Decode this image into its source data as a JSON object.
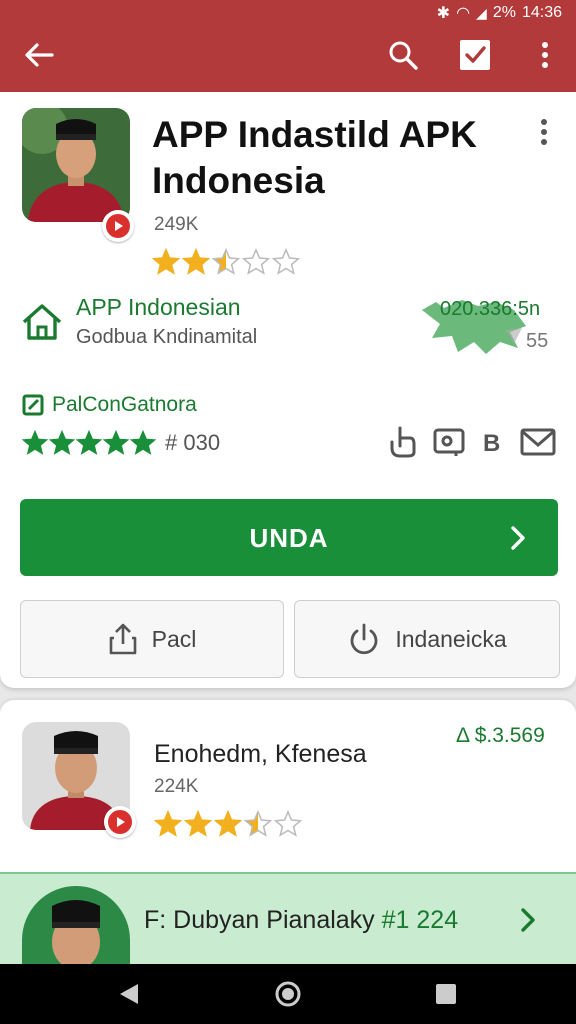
{
  "status_bar": {
    "time": "14:36",
    "battery": "2%"
  },
  "app_bar": {
    "back_icon": "arrow-left-icon",
    "actions": [
      "search-icon",
      "checkbox-icon",
      "more-vert-icon"
    ]
  },
  "app": {
    "title": "APP Indastild APK Indonesia",
    "downloads": "249K",
    "rating": 2.5,
    "developer_name": "APP Indonesian",
    "developer_sub": "Godbua Kndinamital",
    "splash_value": "020.336:5n",
    "splash_number": "55",
    "category": "PalConGatnora",
    "category_rating_count": "# 030",
    "install_label": "UNDA",
    "share_label": "Pacl",
    "secondary_label": "Indaneicka"
  },
  "colors": {
    "app_bar": "#b23a3a",
    "primary_green": "#1a8f3a",
    "star": "#f2b01e"
  },
  "related": [
    {
      "name": "Enohedm, Kfenesa",
      "downloads": "224K",
      "rating": 3.5,
      "price": "Δ $.3.569"
    },
    {
      "name": "F: Dubyan Pianalaky",
      "rank": "#1 224"
    }
  ]
}
